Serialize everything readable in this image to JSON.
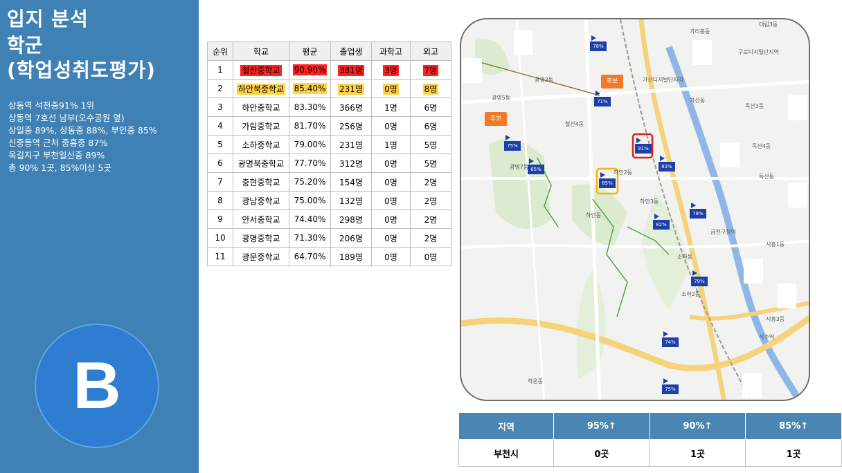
{
  "panel": {
    "title_line1": "입지 분석",
    "title_line2": "학군",
    "title_line3": "(학업성취도평가)",
    "notes": [
      "상동역 석천중91% 1위",
      "상동역 7호선 남부(오수공원 옆)",
      "상일중 89%, 상동중 88%, 부인중 85%",
      "신중동역 근처 중흥중 87%",
      "옥길지구 부천일신중 89%",
      "총 90% 1곳, 85%이상 5곳"
    ],
    "grade": "B"
  },
  "ranking": {
    "headers": [
      "순위",
      "학교",
      "평균",
      "졸업생",
      "과학고",
      "외고"
    ],
    "rows": [
      [
        "1",
        "철산중학교",
        "90.90%",
        "381명",
        "3명",
        "7명"
      ],
      [
        "2",
        "하안북중학교",
        "85.40%",
        "231명",
        "0명",
        "8명"
      ],
      [
        "3",
        "하안중학교",
        "83.30%",
        "366명",
        "1명",
        "6명"
      ],
      [
        "4",
        "가림중학교",
        "81.70%",
        "256명",
        "0명",
        "6명"
      ],
      [
        "5",
        "소하중학교",
        "79.00%",
        "231명",
        "1명",
        "5명"
      ],
      [
        "6",
        "광명북중학교",
        "77.70%",
        "312명",
        "0명",
        "5명"
      ],
      [
        "7",
        "충현중학교",
        "75.20%",
        "154명",
        "0명",
        "2명"
      ],
      [
        "8",
        "광남중학교",
        "75.00%",
        "132명",
        "0명",
        "2명"
      ],
      [
        "9",
        "안서중학교",
        "74.40%",
        "298명",
        "0명",
        "2명"
      ],
      [
        "10",
        "광명중학교",
        "71.30%",
        "206명",
        "0명",
        "2명"
      ],
      [
        "11",
        "광문중학교",
        "64.70%",
        "189명",
        "0명",
        "0명"
      ]
    ],
    "highlight_colors": {
      "red": "#ff2020",
      "yellow": "#ffd24a"
    }
  },
  "map": {
    "candidate_label": "후보",
    "school_flags": [
      {
        "label": "91%",
        "id": "flag-91"
      },
      {
        "label": "85%",
        "id": "flag-85"
      },
      {
        "label": "83%",
        "id": "flag-83"
      },
      {
        "label": "82%",
        "id": "flag-82"
      },
      {
        "label": "78%",
        "id": "flag-78a"
      },
      {
        "label": "78%",
        "id": "flag-78b"
      },
      {
        "label": "79%",
        "id": "flag-79"
      },
      {
        "label": "75%",
        "id": "flag-75a"
      },
      {
        "label": "75%",
        "id": "flag-75b"
      },
      {
        "label": "74%",
        "id": "flag-74"
      },
      {
        "label": "71%",
        "id": "flag-71"
      },
      {
        "label": "65%",
        "id": "flag-65"
      }
    ],
    "place_labels": {
      "gasan": "가산디지털단지역",
      "guro": "구로디지털단지역",
      "geumcheon": "금천구청역",
      "doksan": "독산동",
      "doksan3": "독산3동",
      "doksan4": "독산4동",
      "siheung": "시흥1동",
      "siheung3": "시흥3동",
      "haan": "하안동",
      "haan2": "하안2동",
      "haan3": "하안3동",
      "soha": "소하동",
      "soha2": "소하2동",
      "hakon": "학온동",
      "gwangmyeong3": "광명3동",
      "gwangmyeong5": "광명5동",
      "gwangmyeong7": "광명7동",
      "seoksu": "석수역",
      "gaemyeong": "가리봉동",
      "hwangbong": "대림3동",
      "cheolsan": "철산4동",
      "gasan_dong": "가산동"
    }
  },
  "stats": {
    "headers": [
      "지역",
      "95%↑",
      "90%↑",
      "85%↑"
    ],
    "row": [
      "부천시",
      "0곳",
      "1곳",
      "1곳"
    ],
    "header_color": "#4a86b4"
  }
}
